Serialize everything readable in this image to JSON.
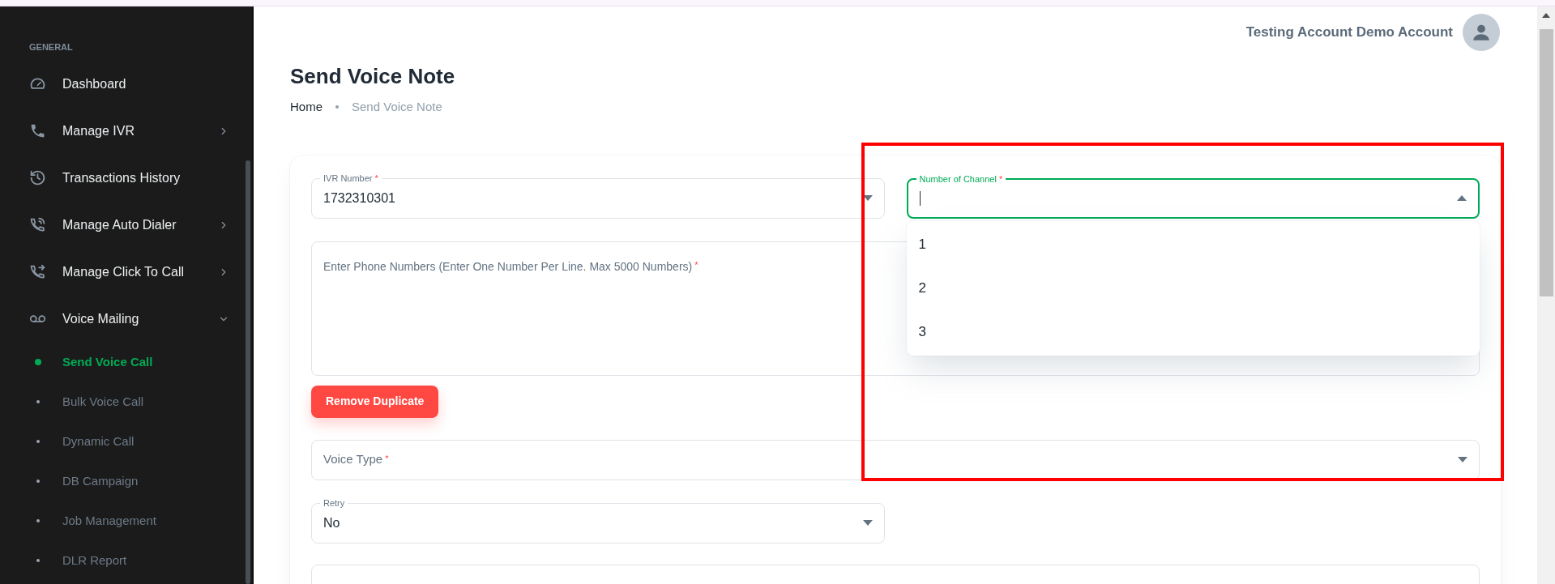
{
  "top_bar": {
    "user_name": "Testing Account Demo Account"
  },
  "sidebar": {
    "section_label": "GENERAL",
    "items": [
      {
        "label": "Dashboard",
        "kind": "link"
      },
      {
        "label": "Manage IVR",
        "kind": "group",
        "expanded": false
      },
      {
        "label": "Transactions History",
        "kind": "link"
      },
      {
        "label": "Manage Auto Dialer",
        "kind": "group",
        "expanded": false
      },
      {
        "label": "Manage Click To Call",
        "kind": "group",
        "expanded": false
      },
      {
        "label": "Voice Mailing",
        "kind": "group",
        "expanded": true,
        "children": [
          {
            "label": "Send Voice Call",
            "selected": true
          },
          {
            "label": "Bulk Voice Call",
            "selected": false
          },
          {
            "label": "Dynamic Call",
            "selected": false
          },
          {
            "label": "DB Campaign",
            "selected": false
          },
          {
            "label": "Job Management",
            "selected": false
          },
          {
            "label": "DLR Report",
            "selected": false
          }
        ]
      }
    ]
  },
  "page": {
    "title": "Send Voice Note",
    "breadcrumb": [
      "Home",
      "Send Voice Note"
    ]
  },
  "form": {
    "ivr_number": {
      "label": "IVR Number",
      "required_mark": "*",
      "value": "1732310301"
    },
    "number_of_channel": {
      "label": "Number of Channel",
      "required_mark": "*",
      "focused": true,
      "expanded": true,
      "options": [
        "1",
        "2",
        "3"
      ]
    },
    "phone_numbers": {
      "label": "Enter Phone Numbers (Enter One Number Per Line. Max 5000 Numbers)",
      "required_mark": "*"
    },
    "remove_duplicate_button": "Remove Duplicate",
    "voice_type": {
      "label": "Voice Type",
      "required_mark": "*"
    },
    "retry": {
      "label": "Retry",
      "value": "No"
    }
  },
  "annotation": {
    "highlight_frame": true
  }
}
